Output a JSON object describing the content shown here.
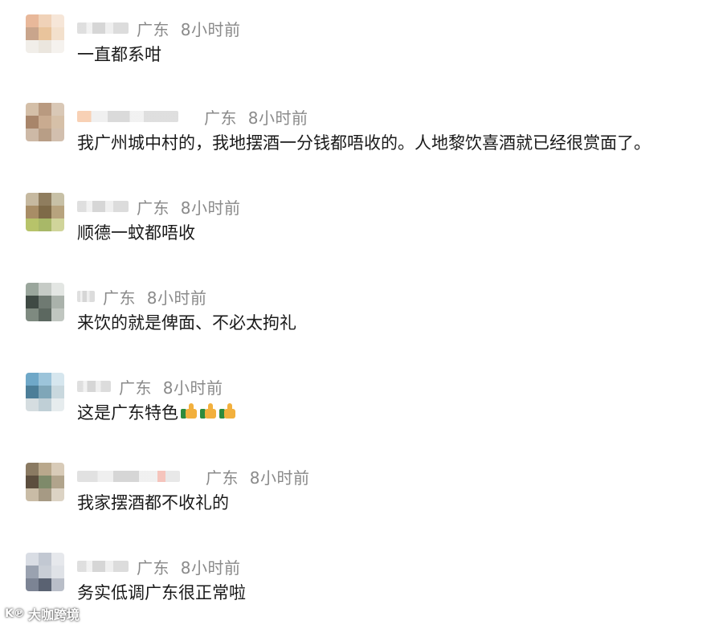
{
  "comments": [
    {
      "location": "广东",
      "time": "8小时前",
      "text": "一直都系咁",
      "likes": 0
    },
    {
      "location": "广东",
      "time": "8小时前",
      "text": "我广州城中村的，我地摆酒一分钱都唔收的。人地黎饮喜酒就已经很赏面了。",
      "likes": 0
    },
    {
      "location": "广东",
      "time": "8小时前",
      "text": "顺德一蚊都唔收",
      "likes": 0
    },
    {
      "location": "广东",
      "time": "8小时前",
      "text": "来饮的就是俾面、不必太拘礼",
      "likes": 0
    },
    {
      "location": "广东",
      "time": "8小时前",
      "text": "这是广东特色",
      "likes": 3
    },
    {
      "location": "广东",
      "time": "8小时前",
      "text": "我家摆酒都不收礼的",
      "likes": 0
    },
    {
      "location": "广东",
      "time": "8小时前",
      "text": "务实低调广东很正常啦",
      "likes": 0
    }
  ],
  "emoji": {
    "name": "thumbs-up-icon"
  },
  "watermark": {
    "logo": "K℗",
    "text": "大咖跨境"
  },
  "colors": {
    "meta": "#8a8a8a",
    "text": "#1a1a1a",
    "thumb_hand": "#f2b03d",
    "thumb_cuff": "#2e8b3d"
  }
}
